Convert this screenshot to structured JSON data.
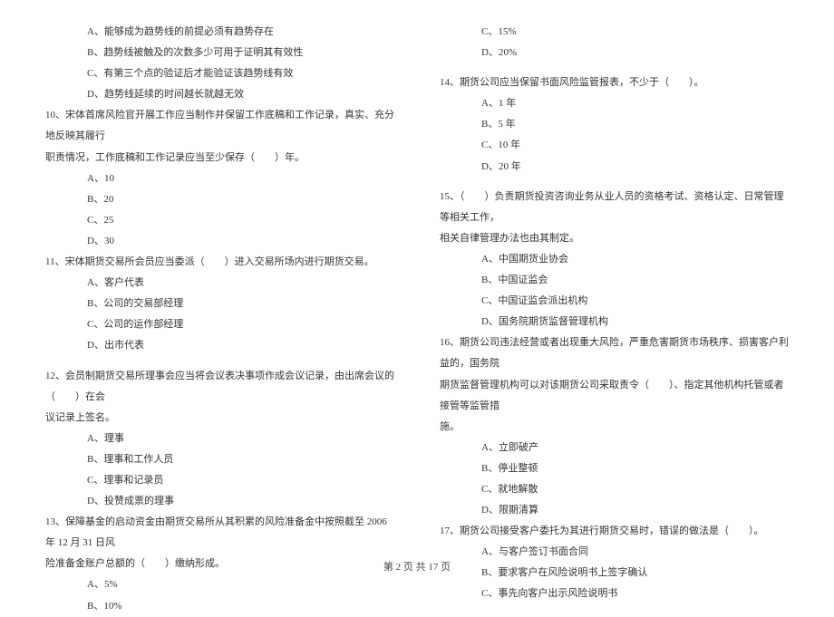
{
  "left": {
    "q9_opts": {
      "A": "A、能够成为趋势线的前提必须有趋势存在",
      "B": "B、趋势线被触及的次数多少可用于证明其有效性",
      "C": "C、有第三个点的验证后才能验证该趋势线有效",
      "D": "D、趋势线延续的时间越长就越无效"
    },
    "q10": {
      "stem1": "10、宋体首席风险官开展工作应当制作并保留工作底稿和工作记录，真实、充分地反映其履行",
      "stem2": "职责情况，工作底稿和工作记录应当至少保存（　　）年。",
      "opts": {
        "A": "A、10",
        "B": "B、20",
        "C": "C、25",
        "D": "D、30"
      }
    },
    "q11": {
      "stem": "11、宋体期货交易所会员应当委派（　　）进入交易所场内进行期货交易。",
      "opts": {
        "A": "A、客户代表",
        "B": "B、公司的交易部经理",
        "C": "C、公司的运作部经理",
        "D": "D、出市代表"
      }
    },
    "q12": {
      "stem1": "12、会员制期货交易所理事会应当将会议表决事项作成会议记录，由出席会议的（　　）在会",
      "stem2": "议记录上签名。",
      "opts": {
        "A": "A、理事",
        "B": "B、理事和工作人员",
        "C": "C、理事和记录员",
        "D": "D、投赞成票的理事"
      }
    },
    "q13": {
      "stem1": "13、保障基金的启动资金由期货交易所从其积累的风险准备金中按照截至 2006 年 12 月 31 日风",
      "stem2": "险准备金账户总额的（　　）缴纳形成。",
      "opts": {
        "A": "A、5%",
        "B": "B、10%"
      }
    }
  },
  "right": {
    "q13_opts_cont": {
      "C": "C、15%",
      "D": "D、20%"
    },
    "q14": {
      "stem": "14、期货公司应当保留书面风险监管报表，不少于（　　）。",
      "opts": {
        "A": "A、1 年",
        "B": "B、5 年",
        "C": "C、10 年",
        "D": "D、20 年"
      }
    },
    "q15": {
      "stem1": "15、（　　）负责期货投资咨询业务从业人员的资格考试、资格认定、日常管理等相关工作，",
      "stem2": "相关自律管理办法也由其制定。",
      "opts": {
        "A": "A、中国期货业协会",
        "B": "B、中国证监会",
        "C": "C、中国证监会派出机构",
        "D": "D、国务院期货监督管理机构"
      }
    },
    "q16": {
      "stem1": "16、期货公司违法经营或者出现重大风险，严重危害期货市场秩序、损害客户利益的，国务院",
      "stem2": "期货监督管理机构可以对该期货公司采取责令（　　）、指定其他机构托管或者接管等监管措",
      "stem3": "施。",
      "opts": {
        "A": "A、立即破产",
        "B": "B、停业整顿",
        "C": "C、就地解散",
        "D": "D、限期清算"
      }
    },
    "q17": {
      "stem": "17、期货公司接受客户委托为其进行期货交易时，错误的做法是（　　）。",
      "opts": {
        "A": "A、与客户签订书面合同",
        "B": "B、要求客户在风险说明书上签字确认",
        "C": "C、事先向客户出示风险说明书"
      }
    }
  },
  "footer": "第 2 页 共 17 页"
}
